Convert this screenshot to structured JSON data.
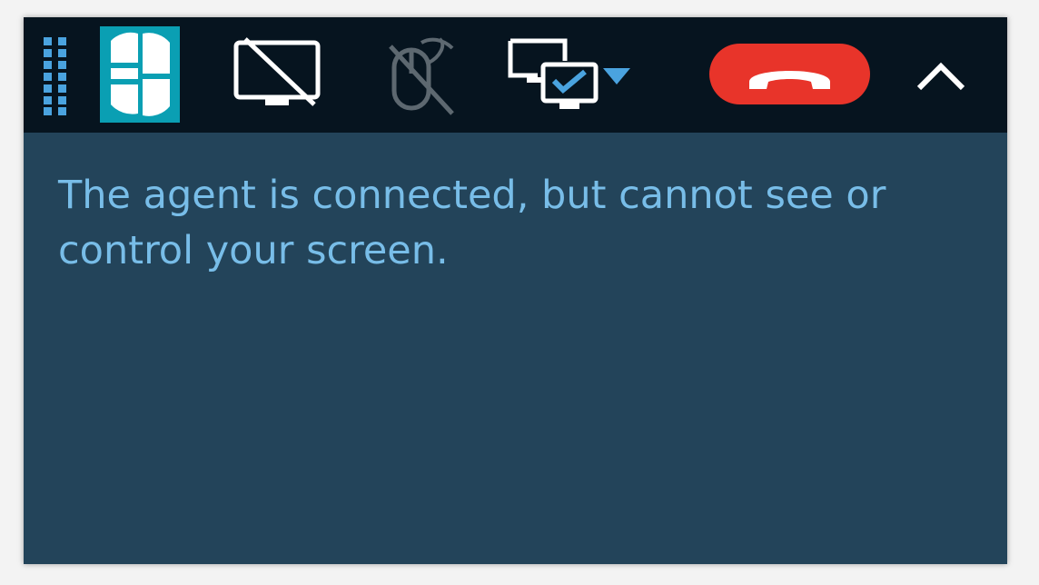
{
  "toolbar": {
    "buttons": [
      {
        "name": "drag-handle",
        "icon": "grip-dots-icon"
      },
      {
        "name": "logo",
        "icon": "app-logo"
      },
      {
        "name": "screen-share",
        "icon": "screen-disabled-icon",
        "state": "disabled"
      },
      {
        "name": "remote-control",
        "icon": "mouse-disabled-icon",
        "state": "disabled"
      },
      {
        "name": "monitor-select",
        "icon": "monitor-select-icon",
        "has_dropdown": true
      },
      {
        "name": "end-session",
        "icon": "hang-up-icon"
      },
      {
        "name": "collapse",
        "icon": "chevron-up-icon"
      }
    ]
  },
  "message": {
    "text": "The agent is connected, but cannot see or control your screen."
  },
  "colors": {
    "toolbar_bg": "#06141f",
    "panel_bg": "#23445a",
    "message_text": "#78bde8",
    "accent_blue": "#4aa3df",
    "logo_teal": "#0a9fb3",
    "hangup_red": "#e8342a",
    "icon_white": "#ffffff",
    "icon_disabled": "#5d6870"
  }
}
